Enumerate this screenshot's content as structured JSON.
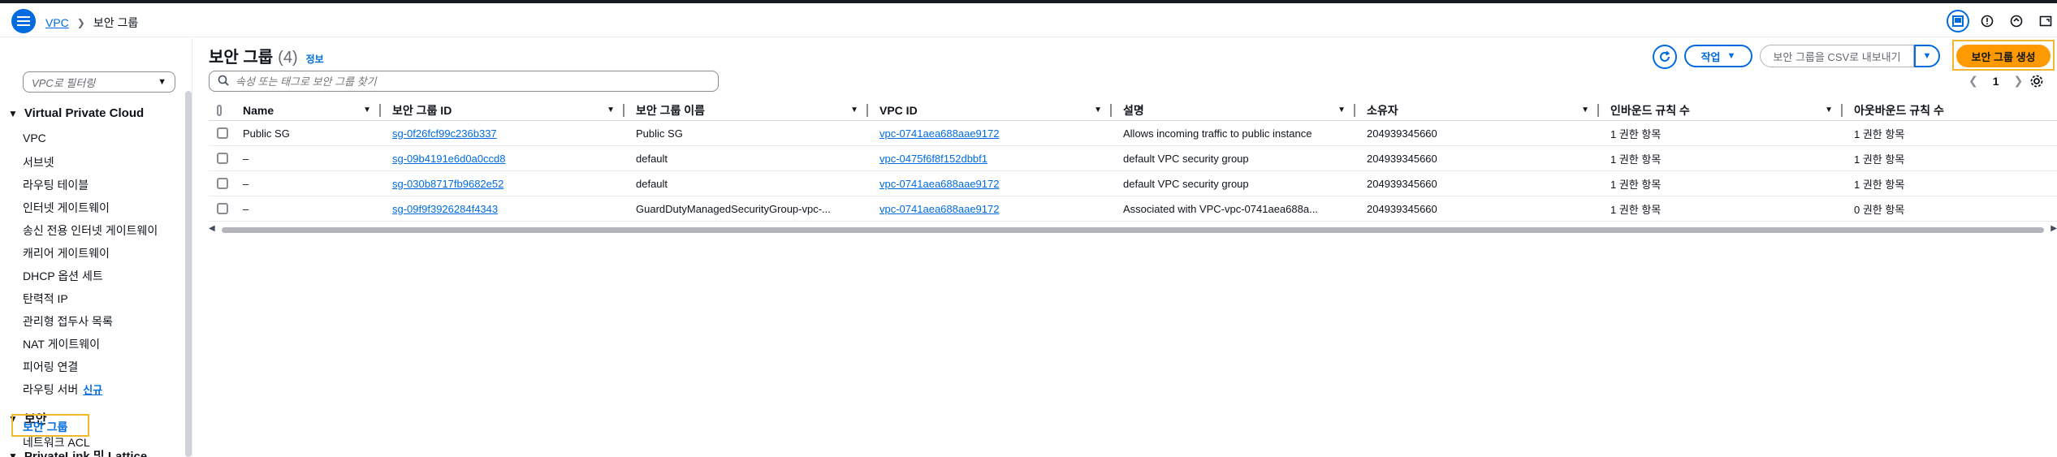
{
  "breadcrumb": {
    "parent": "VPC",
    "current": "보안 그룹"
  },
  "sidebar": {
    "filter_placeholder": "VPC로 필터링",
    "sections": [
      {
        "title": "Virtual Private Cloud"
      },
      {
        "title": "보안"
      },
      {
        "title": "PrivateLink 및 Lattice"
      }
    ],
    "vpc_items": [
      "VPC",
      "서브넷",
      "라우팅 테이블",
      "인터넷 게이트웨이",
      "송신 전용 인터넷 게이트웨이",
      "캐리어 게이트웨이",
      "DHCP 옵션 세트",
      "탄력적 IP",
      "관리형 접두사 목록",
      "NAT 게이트웨이",
      "피어링 연결",
      "라우팅 서버"
    ],
    "new_badge": "신규",
    "security_items": [
      "네트워크 ACL",
      "보안 그룹"
    ]
  },
  "header": {
    "title": "보안 그룹",
    "count": "(4)",
    "info": "정보",
    "search_placeholder": "속성 또는 태그로 보안 그룹 찾기",
    "actions_label": "작업",
    "csv_label": "보안 그룹을 CSV로 내보내기",
    "create_label": "보안 그룹 생성",
    "page_number": "1"
  },
  "table": {
    "columns": [
      "Name",
      "보안 그룹 ID",
      "보안 그룹 이름",
      "VPC ID",
      "설명",
      "소유자",
      "인바운드 규칙 수",
      "아웃바운드 규칙 수"
    ],
    "rows": [
      {
        "name": "Public SG",
        "id": "sg-0f26fcf99c236b337",
        "gname": "Public SG",
        "vpc": "vpc-0741aea688aae9172",
        "desc": "Allows incoming traffic to public instance",
        "owner": "204939345660",
        "inbound": "1 권한 항목",
        "outbound": "1 권한 항목"
      },
      {
        "name": "–",
        "id": "sg-09b4191e6d0a0ccd8",
        "gname": "default",
        "vpc": "vpc-0475f6f8f152dbbf1",
        "desc": "default VPC security group",
        "owner": "204939345660",
        "inbound": "1 권한 항목",
        "outbound": "1 권한 항목"
      },
      {
        "name": "–",
        "id": "sg-030b8717fb9682e52",
        "gname": "default",
        "vpc": "vpc-0741aea688aae9172",
        "desc": "default VPC security group",
        "owner": "204939345660",
        "inbound": "1 권한 항목",
        "outbound": "1 권한 항목"
      },
      {
        "name": "–",
        "id": "sg-09f9f3926284f4343",
        "gname": "GuardDutyManagedSecurityGroup-vpc-...",
        "vpc": "vpc-0741aea688aae9172",
        "desc": "Associated with VPC-vpc-0741aea688a...",
        "owner": "204939345660",
        "inbound": "1 권한 항목",
        "outbound": "0 권한 항목"
      }
    ]
  },
  "colors": {
    "link": "#006ce0",
    "primary": "#ff9900",
    "focus": "#f3b72e",
    "text": "#0f141a"
  },
  "icons": [
    "menu-icon",
    "chevron-right-icon",
    "panel-icon",
    "info-circle-icon",
    "notification-icon",
    "expand-icon",
    "refresh-icon",
    "search-icon",
    "caret-down-icon",
    "chevron-left-icon",
    "gear-icon"
  ]
}
